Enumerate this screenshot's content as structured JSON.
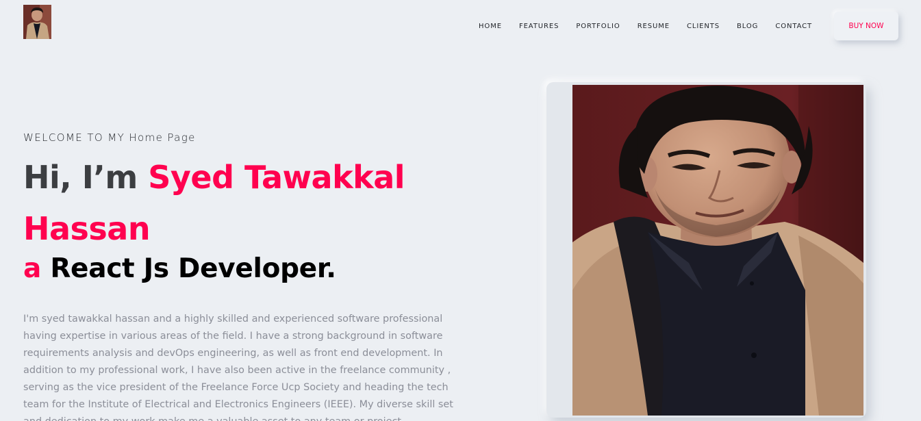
{
  "nav": {
    "items": [
      "HOME",
      "FEATURES",
      "PORTFOLIO",
      "RESUME",
      "CLIENTS",
      "BLOG",
      "CONTACT"
    ],
    "buy_label": "BUY NOW"
  },
  "hero": {
    "welcome": "WELCOME TO MY Home Page",
    "greeting": "Hi, I’m",
    "name": "Syed Tawakkal Hassan",
    "role_article": "a",
    "role": "React Js Developer.",
    "bio": "I'm syed tawakkal hassan and a highly skilled and experienced software professional having expertise in various areas of the field. I have a strong background in software requirements analysis and devOps engineering, as well as front end development. In addition to my professional work, I have also been active in the freelance community , serving as the vice president of the Freelance Force Ucp Society and heading the tech team for the Institute of Electrical and Electronics Engineers (IEEE). My diverse skill set and dedication to my work make me a valuable asset to any team or project."
  },
  "colors": {
    "accent": "#ff014f",
    "background": "#eceff3",
    "heading": "#3c3e41",
    "body_text": "#8b8e98"
  },
  "images": {
    "logo": "profile-photo-thumbnail",
    "portrait": "profile-photo-portrait"
  }
}
